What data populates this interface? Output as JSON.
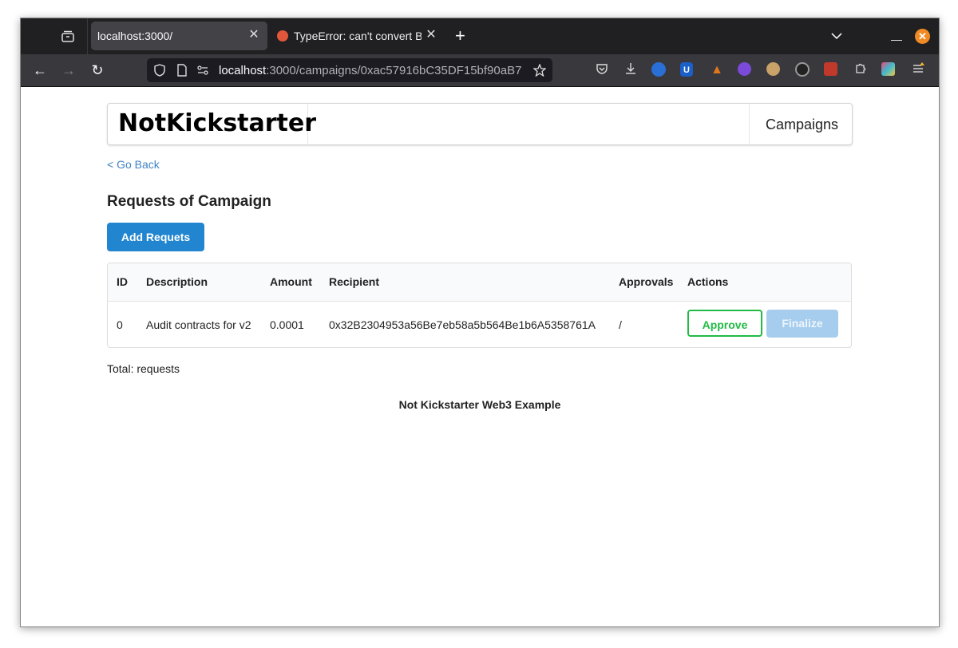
{
  "browser": {
    "tabs": [
      {
        "label": "localhost:3000/",
        "active": true
      },
      {
        "label": "TypeError: can't convert BI",
        "active": false
      }
    ],
    "new_tab": "+",
    "url_host": "localhost",
    "url_rest": ":3000/campaigns/0xac57916bC35DF15bf90aB7",
    "icons": {
      "tab_list": "tab-list-icon",
      "back": "back-arrow-icon",
      "forward": "forward-arrow-icon",
      "reload": "reload-icon"
    },
    "colors": {
      "accent": "#2185d0",
      "approve": "#21ba45",
      "finalize": "#a6cdee",
      "link": "#4183c4"
    }
  },
  "app": {
    "brand": "NotKickstarter",
    "nav_campaigns": "Campaigns",
    "go_back": "< Go Back",
    "title": "Requests of Campaign",
    "add_button": "Add Requets",
    "table": {
      "headers": [
        "ID",
        "Description",
        "Amount",
        "Recipient",
        "Approvals",
        "Actions"
      ],
      "rows": [
        {
          "id": "0",
          "description": "Audit contracts for v2",
          "amount": "0.0001",
          "recipient": "0x32B2304953a56Be7eb58a5b564Be1b6A5358761A",
          "approvals": "/",
          "approve_label": "Approve",
          "finalize_label": "Finalize"
        }
      ]
    },
    "total": "Total: requests",
    "footer": "Not Kickstarter Web3 Example"
  }
}
